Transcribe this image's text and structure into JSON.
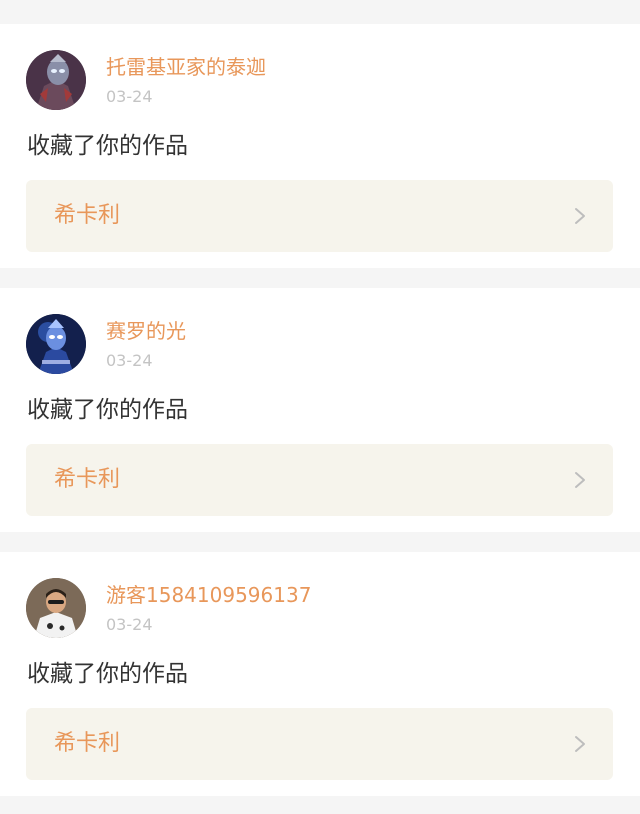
{
  "notifications": [
    {
      "username": "托雷基亚家的泰迦",
      "date": "03-24",
      "action": "收藏了你的作品",
      "work_title": "希卡利",
      "avatar_icon": "avatar-ultraman-dark-icon"
    },
    {
      "username": "赛罗的光",
      "date": "03-24",
      "action": "收藏了你的作品",
      "work_title": "希卡利",
      "avatar_icon": "avatar-ultraman-blue-icon"
    },
    {
      "username": "游客1584109596137",
      "date": "03-24",
      "action": "收藏了你的作品",
      "work_title": "希卡利",
      "avatar_icon": "avatar-person-photo-icon"
    }
  ],
  "colors": {
    "page_background": "#f5f5f5",
    "card_background": "#ffffff",
    "accent": "#e8975a",
    "date_text": "#c4c4c4",
    "body_text": "#333333",
    "link_box": "#f6f4ec",
    "chevron": "#bdbdbd"
  }
}
